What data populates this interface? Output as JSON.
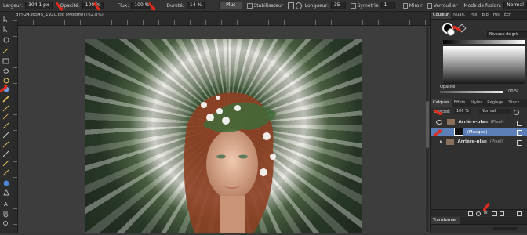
{
  "context_toolbar": {
    "width_label": "Largeur:",
    "width_value": "304,1 px",
    "opacity_label": "Opacité:",
    "opacity_value": "100 %",
    "flow_label": "Flux:",
    "flow_value": "100 %",
    "hardness_label": "Dureté:",
    "hardness_value": "14 %",
    "more_button": "Plus",
    "stabilizer_label": "Stabilisateur",
    "length_label": "Longueur:",
    "length_value": "35",
    "symmetry_label": "Symétrie",
    "symmetry_value": "1",
    "mirror_label": "Miroir",
    "lock_label": "Verrouiller",
    "blend_mode_label": "Mode de fusion:",
    "blend_mode_value": "Normal"
  },
  "document": {
    "tab_title": "girl-2436545_1920.jpg [Modifié] (62,8%)"
  },
  "color_panel": {
    "tabs": [
      "Couleur",
      "Nuan.",
      "Pox",
      "Bib",
      "His",
      "Éch"
    ],
    "active_tab": "Couleur",
    "model_dropdown": "Niveaux de gris",
    "opacity_label": "Opacité",
    "opacity_value": "100 %"
  },
  "layers_panel": {
    "tabs": [
      "Calques",
      "Effets",
      "Styles",
      "Réglage",
      "Stock"
    ],
    "active_tab": "Calques",
    "opacity_label": "Opacité:",
    "opacity_value": "100 %",
    "blend_value": "Normal",
    "layers": [
      {
        "name": "Arrière-plan",
        "suffix": "(Pixel)",
        "selected": false
      },
      {
        "name": "(Masque)",
        "suffix": "",
        "selected": true
      },
      {
        "name": "Arrière-plan",
        "suffix": "(Pixel)",
        "selected": false
      }
    ]
  },
  "transform_panel": {
    "tab": "Transformer"
  },
  "colors": {
    "accent_arrow": "#e02b1d",
    "selection": "#5c7fb8"
  }
}
